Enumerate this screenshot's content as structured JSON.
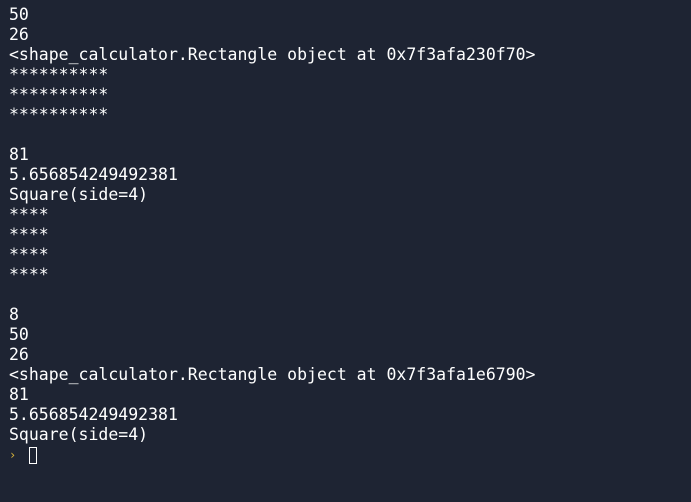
{
  "terminal": {
    "lines": [
      "50",
      "26",
      "<shape_calculator.Rectangle object at 0x7f3afa230f70>",
      "**********",
      "**********",
      "**********",
      "",
      "81",
      "5.656854249492381",
      "Square(side=4)",
      "****",
      "****",
      "****",
      "****",
      "",
      "8",
      "50",
      "26",
      "<shape_calculator.Rectangle object at 0x7f3afa1e6790>",
      "81",
      "5.656854249492381",
      "Square(side=4)"
    ],
    "prompt_symbol": "›",
    "prompt_color": "#d7b23a",
    "background": "#1e2433",
    "foreground": "#ffffff"
  }
}
